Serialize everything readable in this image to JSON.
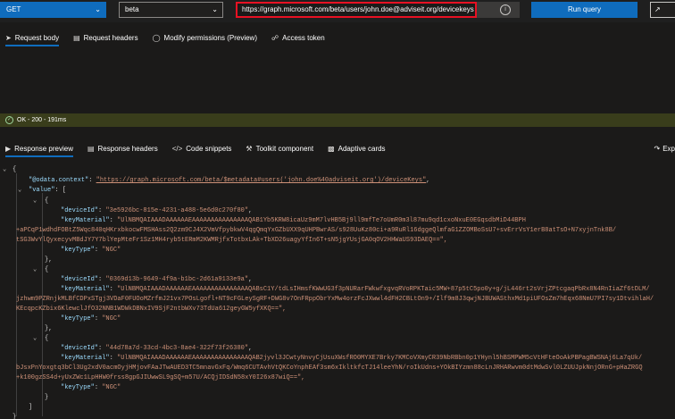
{
  "query": {
    "method": "GET",
    "version": "beta",
    "url": "https://graph.microsoft.com/beta/users/john.doe@adviseit.org/devicekeys",
    "run_label": "Run query",
    "edge_label": "↗"
  },
  "request_tabs": [
    {
      "label": "Request body",
      "icon": "send-icon"
    },
    {
      "label": "Request headers",
      "icon": "document-icon"
    },
    {
      "label": "Modify permissions (Preview)",
      "icon": "shield-icon"
    },
    {
      "label": "Access token",
      "icon": "key-icon"
    }
  ],
  "status": {
    "text": "OK - 200 - 191ms"
  },
  "response_tabs": [
    {
      "label": "Response preview",
      "icon": "preview-icon"
    },
    {
      "label": "Response headers",
      "icon": "document-icon"
    },
    {
      "label": "Code snippets",
      "icon": "code-icon"
    },
    {
      "label": "Toolkit component",
      "icon": "toolkit-icon"
    },
    {
      "label": "Adaptive cards",
      "icon": "card-icon"
    },
    {
      "label": "Exp",
      "icon": "export-icon"
    }
  ],
  "response": {
    "open_brace": "{",
    "context_key": "\"@odata.context\"",
    "context_value": "\"https://graph.microsoft.com/beta/$metadata#users('john.doe%40adviseit.org')/deviceKeys\"",
    "value_key": "\"value\"",
    "items": [
      {
        "deviceId": "\"3e5926bc-815e-4231-a488-5e6d0c270f80\"",
        "keyMaterial_lines": [
          "\"UlNBMQAIAAADAAAAAAEAAAAAAAAAAAAAAAQAB1Yb5KRW8icaUz9mM7lvHB5Bj9ll9mfTe7oUmR0m3l87mu9qd1cxoNxuE0EGqsdbMiD44BPH",
          "+aPCqP1wdhdFOBtZ5Wqc840qHKrxbkocwFMSHAss2Q2zm9CJ4X2VmVfpybkwV4qgQmqYxGZbUXX9qUHPBwrAS/s928UuKz80ci+a9RuRl16dggeQlmfaG1ZZOMBoSsU7+svErrVsY1erB8atTsO+N7xyjnTnk8B/",
          "tSG3WvYlQyxecyvMBdJY7Y7blYepMteFr1Sz1MH4ryb5tERmM2KWMRjfxTotbxLAk+TbXD26uagyYfIn6T+sN5jgYUsjGA0qOV2HHWaUS93DAEQ==\","
        ],
        "keyType": "\"NGC\""
      },
      {
        "deviceId": "\"0369d13b-9649-4f9a-b1bc-2d61a9133e9a\"",
        "keyMaterial_lines": [
          "\"UlNBMQAIAAADAAAAAAEAAAAAAAAAAAAAAAQABsC1Y/tdLsIHmsfKWwUG3f3pNURarFWkwfxgvqRVoRPKTaic5MW+87p5tC5po0y+g/jL446rt2sVrjZPtcgaqPbRx8N4RnIiaZf6tDLM/",
          "jzhwm9PZRnjkMLBfCDPxSTgj3VDaF0FUOoMZrfmJ21vx7POsLgofl+NT9cFGLeySgRF+DWG8v7OnFRppObrYxMw4orzFcJXwwl4dFH2CBLtOn9+/Ilf9m8J3qwjNJBUWASthxMd1piUFOsZm7hEqx68NmU7PI7sy1DtvihlaH/",
          "KEcqpcKZbix6KlewclJfO32NNB1WDWkDBNxIV9SjF2ntbWXv73TdUa612geyGW5yfXKQ==\","
        ],
        "keyType": "\"NGC\""
      },
      {
        "deviceId": "\"44d78a7d-33cd-4bc3-8ae4-322f73f26380\"",
        "keyMaterial_lines": [
          "\"UlNBMQAIAAADAAAAAAEAAAAAAAAAAAAAAAQAB2jyvl3JCwtyNnvyCjUsuXWsfRO0MYXE7Brky7KMCoVXmyCR39NbRBbn0p1YHynl5hBSMPWM5cVtHFteOoAkPBPagBWSNAj6La7qUk/",
          "bJsxPnYoxgtq3bCl3Ug2xdV0acmOyjHMjovFAaJTwAUED3TC5mnavGxFq/Wmq6CUTAvhVtQKCoYnphEAf3sm6xIkltkfcTJ14leeYhN/roIkUdns+YOkBIYzmn88cLnJRHARwvm0dtMdwSvl0LZUUJpkNnjORnG+pHaZRGQ",
          "+k100gzSS4d+yUxZWc1LpHHW0frss8gpGJIUwwSL9gSQ+m57U/ACQjIDSdN58xY0I26x87wiQ==\","
        ],
        "keyType": "\"NGC\""
      }
    ]
  }
}
